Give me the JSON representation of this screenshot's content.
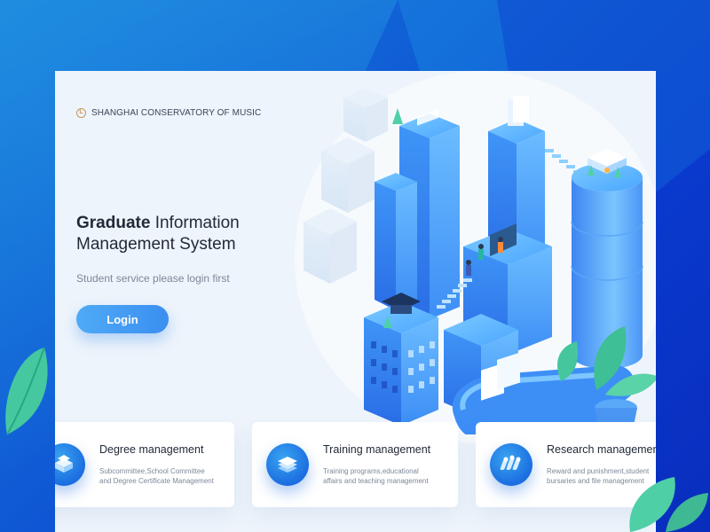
{
  "brand": {
    "logo": "L",
    "name": "SHANGHAI CONSERVATORY OF MUSIC"
  },
  "hero": {
    "title_bold": "Graduate",
    "title_rest_line1": " Information",
    "title_line2": "Management System",
    "subtitle": "Student service please login first",
    "login_label": "Login"
  },
  "features": [
    {
      "title": "Degree management",
      "desc_line1": "Subcommittee,School Committee",
      "desc_line2": "and Degree Certificate Management",
      "icon": "degree-icon"
    },
    {
      "title": "Training management",
      "desc_line1": "Training programs,educational",
      "desc_line2": "affairs and teaching management",
      "icon": "training-icon"
    },
    {
      "title": "Research management",
      "desc_line1": "Reward and punishment,student",
      "desc_line2": "bursaries and file management",
      "icon": "research-icon"
    }
  ],
  "colors": {
    "accent": "#3b8ff0",
    "brand_gold": "#c49a55",
    "card_bg": "#eef4fb"
  }
}
